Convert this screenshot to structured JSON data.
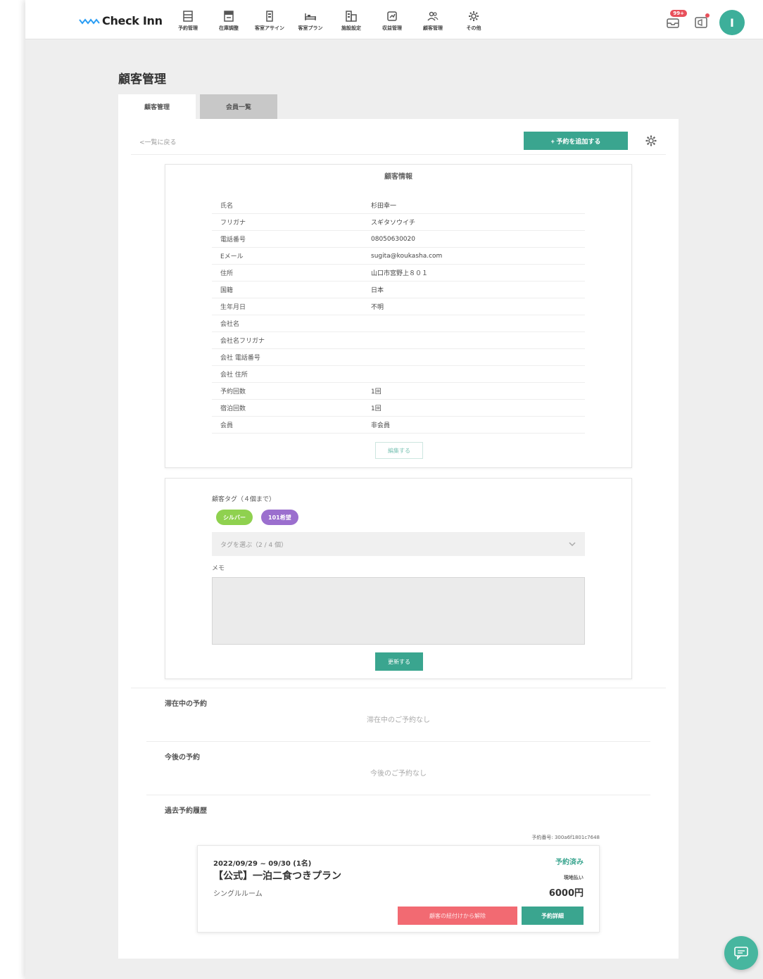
{
  "brand": {
    "name": "Check Inn"
  },
  "nav": [
    {
      "label": "予約管理",
      "icon": "list-icon"
    },
    {
      "label": "在庫調整",
      "icon": "inbox-icon"
    },
    {
      "label": "客室アサイン",
      "icon": "building-icon"
    },
    {
      "label": "客室プラン",
      "icon": "bed-icon"
    },
    {
      "label": "施設設定",
      "icon": "facility-icon"
    },
    {
      "label": "収益管理",
      "icon": "chart-icon"
    },
    {
      "label": "顧客管理",
      "icon": "users-icon"
    },
    {
      "label": "その他",
      "icon": "gear-icon"
    }
  ],
  "header": {
    "notification_badge": "99+",
    "avatar_initial": "I"
  },
  "page": {
    "title": "顧客管理"
  },
  "tabs": [
    {
      "label": "顧客管理",
      "active": true
    },
    {
      "label": "会員一覧",
      "active": false
    }
  ],
  "toolbar": {
    "back_label": "<一覧に戻る",
    "add_reservation_label": "+ 予約を追加する"
  },
  "customer_info": {
    "title": "顧客情報",
    "rows": [
      {
        "label": "氏名",
        "value": "杉田幸一"
      },
      {
        "label": "フリガナ",
        "value": "スギタソウイチ"
      },
      {
        "label": "電話番号",
        "value": "08050630020"
      },
      {
        "label": "Eメール",
        "value": "sugita@koukasha.com"
      },
      {
        "label": "住所",
        "value": "山口市宮野上８０１"
      },
      {
        "label": "国籍",
        "value": "日本"
      },
      {
        "label": "生年月日",
        "value": "不明"
      },
      {
        "label": "会社名",
        "value": ""
      },
      {
        "label": "会社名フリガナ",
        "value": ""
      },
      {
        "label": "会社 電話番号",
        "value": ""
      },
      {
        "label": "会社 住所",
        "value": ""
      },
      {
        "label": "予約回数",
        "value": "1回"
      },
      {
        "label": "宿泊回数",
        "value": "1回"
      },
      {
        "label": "会員",
        "value": "非会員"
      }
    ],
    "edit_label": "編集する"
  },
  "tags_section": {
    "label": "顧客タグ（４個まで）",
    "tags": [
      {
        "label": "シルバー",
        "color": "#8fd14f"
      },
      {
        "label": "101希望",
        "color": "#9b6fce"
      }
    ],
    "select_placeholder": "タグを選ぶ（2 / 4 個）",
    "memo_label": "メモ",
    "memo_value": "",
    "update_label": "更新する"
  },
  "staying": {
    "title": "滞在中の予約",
    "empty": "滞在中のご予約なし"
  },
  "upcoming": {
    "title": "今後の予約",
    "empty": "今後のご予約なし"
  },
  "past": {
    "title": "過去予約履歴",
    "reservation_number": "予約番号: 300a6f1801c7648",
    "card": {
      "dates": "2022/09/29 ~ 09/30 (1名)",
      "plan": "【公式】一泊二食つきプラン",
      "room": "シングルルーム",
      "status": "予約済み",
      "payment": "現地払い",
      "price": "6000円",
      "unlink_label": "顧客の紐付けから解除",
      "detail_label": "予約詳細"
    }
  },
  "colors": {
    "primary": "#3aa58f",
    "danger": "#f26a72",
    "avatar": "#3daf9a"
  }
}
